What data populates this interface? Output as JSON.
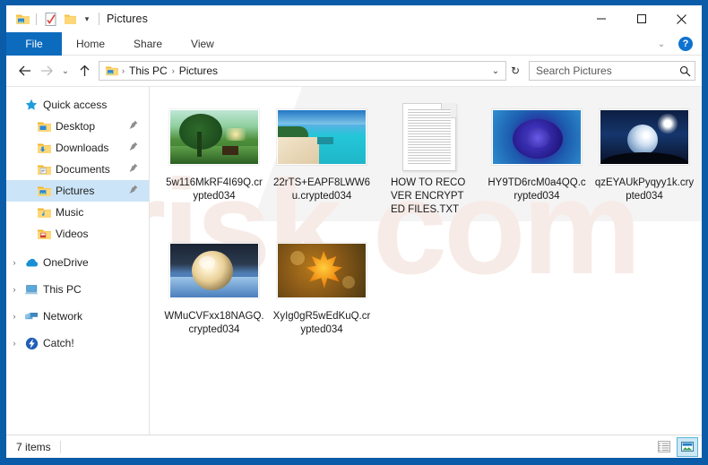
{
  "window": {
    "title": "Pictures",
    "accent_color": "#0d6bbd",
    "frame_color": "#0a5ca8",
    "selection_color": "#cce4f7",
    "watermark": "risk.com",
    "quick_access_toolbar": [
      {
        "name": "pictures-folder-icon",
        "label": "Pictures"
      },
      {
        "name": "properties-icon",
        "label": "Properties"
      },
      {
        "name": "new-folder-icon",
        "label": "New folder"
      },
      {
        "name": "customize-qat-chevron-icon",
        "label": "Customize Quick Access Toolbar"
      }
    ],
    "controls": {
      "minimize": "─",
      "maximize": "□",
      "close": "✕"
    }
  },
  "ribbon": {
    "tabs": [
      {
        "label": "File",
        "selected": true
      },
      {
        "label": "Home",
        "selected": false
      },
      {
        "label": "Share",
        "selected": false
      },
      {
        "label": "View",
        "selected": false
      }
    ],
    "expand_label": "⌄",
    "help_label": "?"
  },
  "address_bar": {
    "back": "←",
    "forward": "→",
    "recent": "⌄",
    "up": "↑",
    "breadcrumb": [
      "This PC",
      "Pictures"
    ],
    "separator": "›",
    "dropdown": "⌄",
    "refresh": "↻"
  },
  "search": {
    "placeholder": "Search Pictures",
    "icon": "search-icon"
  },
  "sidebar": {
    "items": [
      {
        "label": "Quick access",
        "icon": "star-icon",
        "expander": "ⱟ",
        "level": 0,
        "selected": false,
        "pinned": false
      },
      {
        "label": "Desktop",
        "icon": "desktop-folder-icon",
        "expander": "",
        "level": 1,
        "selected": false,
        "pinned": true
      },
      {
        "label": "Downloads",
        "icon": "downloads-folder-icon",
        "expander": "",
        "level": 1,
        "selected": false,
        "pinned": true
      },
      {
        "label": "Documents",
        "icon": "documents-folder-icon",
        "expander": "",
        "level": 1,
        "selected": false,
        "pinned": true
      },
      {
        "label": "Pictures",
        "icon": "pictures-folder-icon",
        "expander": "",
        "level": 1,
        "selected": true,
        "pinned": true
      },
      {
        "label": "Music",
        "icon": "music-folder-icon",
        "expander": "",
        "level": 1,
        "selected": false,
        "pinned": false
      },
      {
        "label": "Videos",
        "icon": "videos-folder-icon",
        "expander": "",
        "level": 1,
        "selected": false,
        "pinned": false
      },
      {
        "label": "OneDrive",
        "icon": "onedrive-cloud-icon",
        "expander": "›",
        "level": 0,
        "selected": false,
        "pinned": false
      },
      {
        "label": "This PC",
        "icon": "this-pc-icon",
        "expander": "›",
        "level": 0,
        "selected": false,
        "pinned": false
      },
      {
        "label": "Network",
        "icon": "network-icon",
        "expander": "›",
        "level": 0,
        "selected": false,
        "pinned": false
      },
      {
        "label": "Catch!",
        "icon": "catch-icon",
        "expander": "›",
        "level": 0,
        "selected": false,
        "pinned": false
      }
    ]
  },
  "files": [
    {
      "name": "5w116MkRF4I69Q.crypted034",
      "type": "image",
      "thumb": "green-tree-sunset"
    },
    {
      "name": "22rTS+EAPF8LWW6u.crypted034",
      "type": "image",
      "thumb": "tropical-beach"
    },
    {
      "name": "HOW TO RECOVER ENCRYPTED FILES.TXT",
      "type": "text",
      "thumb": "text-document"
    },
    {
      "name": "HY9TD6rcM0a4QQ.crypted034",
      "type": "image",
      "thumb": "blue-rose"
    },
    {
      "name": "qzEYAUkPyqyy1k.crypted034",
      "type": "image",
      "thumb": "glass-sphere-moon"
    },
    {
      "name": "WMuCVFxx18NAGQ.crypted034",
      "type": "image",
      "thumb": "frozen-bubble-snow"
    },
    {
      "name": "XyIg0gR5wEdKuQ.crypted034",
      "type": "image",
      "thumb": "autumn-maple-leaf"
    }
  ],
  "status_bar": {
    "item_count": "7 items",
    "views": [
      {
        "name": "details-view-button",
        "active": false
      },
      {
        "name": "large-icons-view-button",
        "active": true
      }
    ]
  }
}
